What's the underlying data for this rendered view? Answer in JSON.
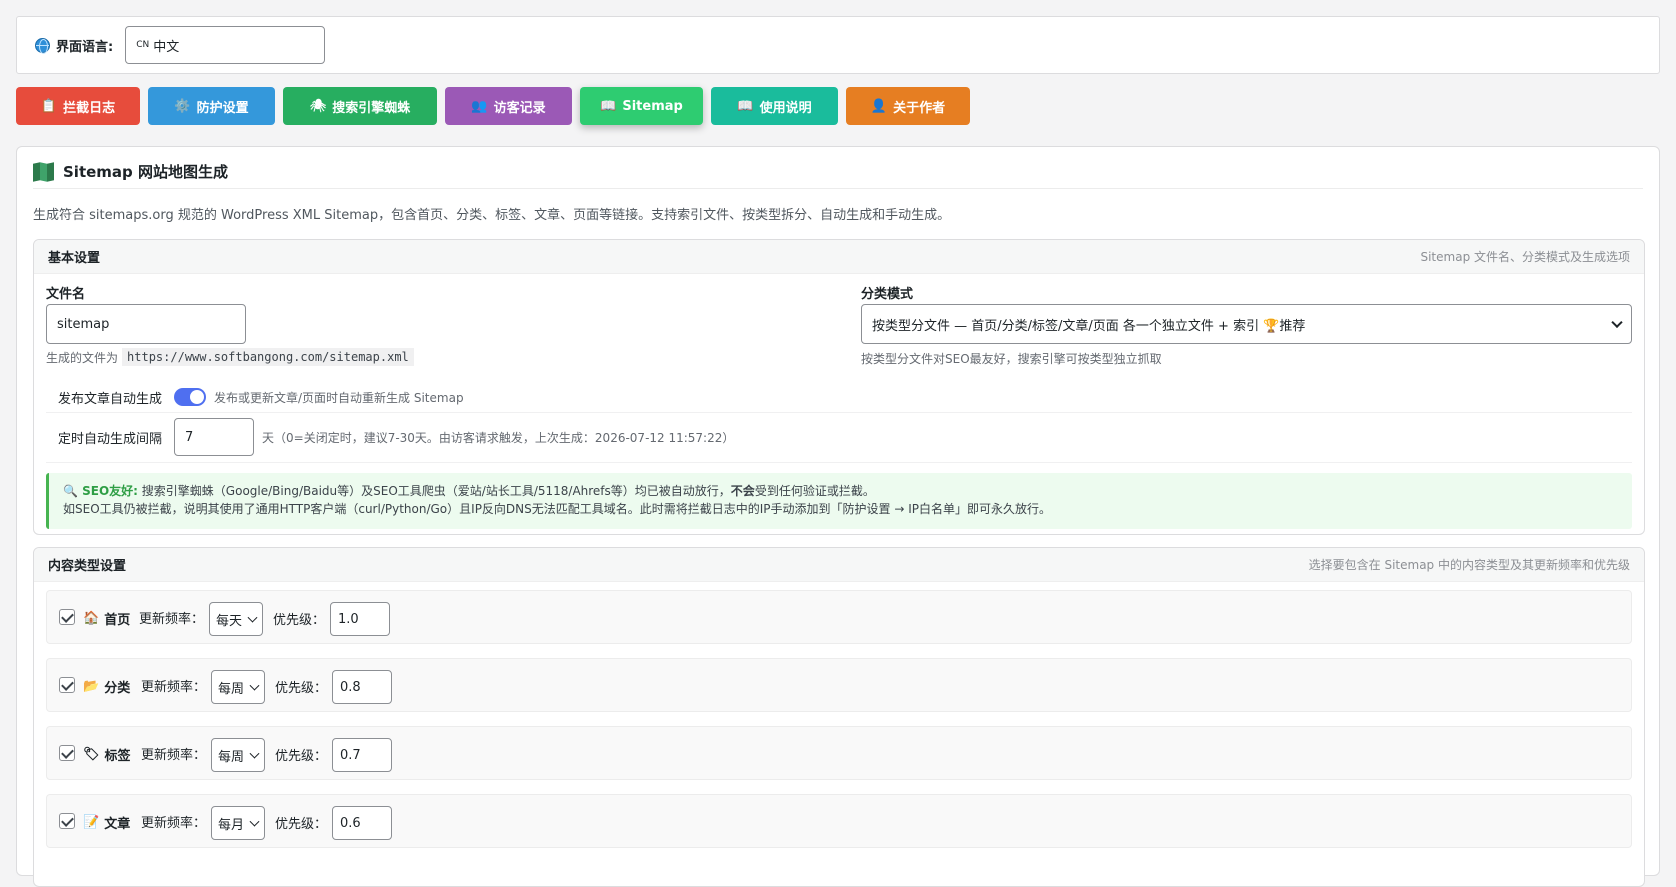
{
  "language": {
    "label": "界面语言:",
    "flag": "CN",
    "value": "中文"
  },
  "tabs": [
    {
      "icon": "📋",
      "label": "拦截日志",
      "color": "#e74c3c"
    },
    {
      "icon": "⚙️",
      "label": "防护设置",
      "color": "#3498db"
    },
    {
      "icon": "🕷",
      "label": "搜索引擎蜘蛛",
      "color": "#27ae60"
    },
    {
      "icon": "👥",
      "label": "访客记录",
      "color": "#9b59b6"
    },
    {
      "icon": "📖",
      "label": "Sitemap",
      "color": "#2ecc71"
    },
    {
      "icon": "📖",
      "label": "使用说明",
      "color": "#1abc9c"
    },
    {
      "icon": "👤",
      "label": "关于作者",
      "color": "#e67e22"
    }
  ],
  "panel": {
    "title": "Sitemap 网站地图生成",
    "description": "生成符合 sitemaps.org 规范的 WordPress XML Sitemap，包含首页、分类、标签、文章、页面等链接。支持索引文件、按类型拆分、自动生成和手动生成。"
  },
  "basic": {
    "title": "基本设置",
    "subtitle": "Sitemap 文件名、分类模式及生成选项",
    "filename_label": "文件名",
    "filename_value": "sitemap",
    "filename_hint_prefix": "生成的文件为",
    "filename_hint_url": "https://www.softbangong.com/sitemap.xml",
    "mode_label": "分类模式",
    "mode_value": "按类型分文件 — 首页/分类/标签/文章/页面 各一个独立文件 + 索引 🏆推荐",
    "mode_hint": "按类型分文件对SEO最友好，搜索引擎可按类型独立抓取",
    "auto_label": "发布文章自动生成",
    "auto_hint": "发布或更新文章/页面时自动重新生成 Sitemap",
    "interval_label": "定时自动生成间隔",
    "interval_value": "7",
    "interval_hint": "天（0=关闭定时，建议7-30天。由访客请求触发，上次生成：2026-07-12 11:57:22）",
    "notice_title": "🔍 SEO友好:",
    "notice_line1_a": "搜索引擎蜘蛛（Google/Bing/Baidu等）及SEO工具爬虫（爱站/站长工具/5118/Ahrefs等）均已被自动放行，",
    "notice_line1_bold": "不会",
    "notice_line1_b": "受到任何验证或拦截。",
    "notice_line2": "如SEO工具仍被拦截，说明其使用了通用HTTP客户端（curl/Python/Go）且IP反向DNS无法匹配工具域名。此时需将拦截日志中的IP手动添加到「防护设置 → IP白名单」即可永久放行。"
  },
  "content_types": {
    "title": "内容类型设置",
    "subtitle": "选择要包含在 Sitemap 中的内容类型及其更新频率和优先级",
    "freq_label": "更新频率：",
    "priority_label": "优先级：",
    "rows": [
      {
        "icon": "🏠",
        "name": "首页",
        "freq": "每天",
        "priority": "1.0"
      },
      {
        "icon": "📂",
        "name": "分类",
        "freq": "每周",
        "priority": "0.8"
      },
      {
        "icon": "🏷",
        "name": "标签",
        "freq": "每周",
        "priority": "0.7"
      },
      {
        "icon": "📝",
        "name": "文章",
        "freq": "每月",
        "priority": "0.6"
      }
    ]
  }
}
